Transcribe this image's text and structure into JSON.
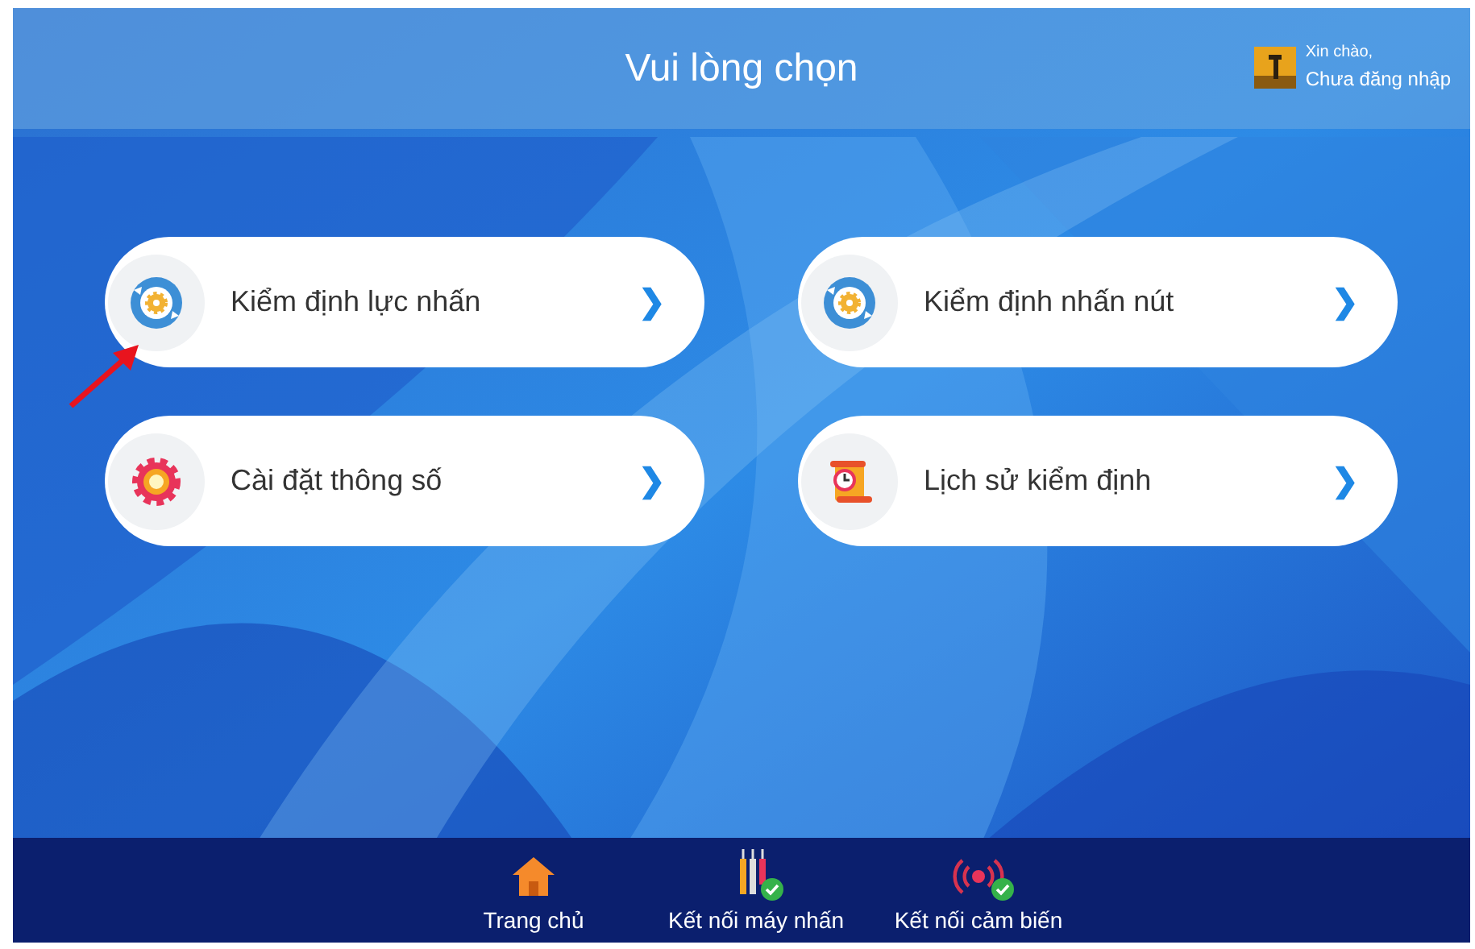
{
  "header": {
    "title": "Vui lòng chọn",
    "user": {
      "greeting": "Xin chào,",
      "status": "Chưa đăng nhập"
    }
  },
  "menu": [
    {
      "label": "Kiểm định lực nhấn",
      "kind": "cycle",
      "arrow": "❯"
    },
    {
      "label": "Kiểm định nhấn nút",
      "kind": "cycle",
      "arrow": "❯"
    },
    {
      "label": "Cài đặt thông số",
      "kind": "settings",
      "arrow": "❯"
    },
    {
      "label": "Lịch sử kiểm định",
      "kind": "history",
      "arrow": "❯"
    }
  ],
  "bottom_bar": [
    {
      "label": "Trang chủ",
      "kind": "home",
      "connected": false
    },
    {
      "label": "Kết nối máy nhấn",
      "kind": "press",
      "connected": true
    },
    {
      "label": "Kết nối cảm biến",
      "kind": "sensor",
      "connected": true
    }
  ]
}
